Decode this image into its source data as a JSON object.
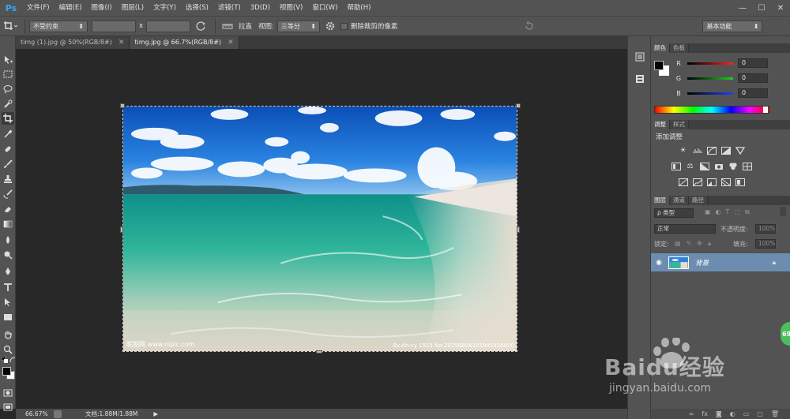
{
  "app": {
    "logo": "Ps",
    "menu": [
      "文件(F)",
      "编辑(E)",
      "图像(I)",
      "图层(L)",
      "文字(Y)",
      "选择(S)",
      "滤镜(T)",
      "3D(D)",
      "视图(V)",
      "窗口(W)",
      "帮助(H)"
    ],
    "window_controls": [
      "—",
      "☐",
      "✕"
    ]
  },
  "options_bar": {
    "constraint_select": "不受约束",
    "x_label": "x",
    "straighten_label": "拉直",
    "view_label": "视图:",
    "view_select": "三等分",
    "delete_cropped_label": "删除裁剪的像素",
    "workspace_select": "基本功能"
  },
  "tabs": [
    {
      "label": "timg (1).jpg @ 50%(RGB/8#)",
      "close": "✕"
    },
    {
      "label": "timg.jpg @ 66.7%(RGB/8#)",
      "close": "✕"
    }
  ],
  "image_watermarks": {
    "left": "昵图网 www.nipic.com",
    "right": "By:Ah-cy 1915 No:20150804101941938000"
  },
  "status": {
    "zoom": "66.67%",
    "doc_info": "文档:1.88M/1.88M",
    "arrow": "▶"
  },
  "color_panel": {
    "tabs": [
      "颜色",
      "色板"
    ],
    "channels": [
      {
        "label": "R",
        "value": "0",
        "color": "#ff2020"
      },
      {
        "label": "G",
        "value": "0",
        "color": "#20d020"
      },
      {
        "label": "B",
        "value": "0",
        "color": "#2040ff"
      }
    ]
  },
  "adjustments_panel": {
    "tabs": [
      "调整",
      "样式"
    ],
    "title": "添加调整"
  },
  "layers_panel": {
    "tabs": [
      "图层",
      "通道",
      "路径"
    ],
    "filter_select": "ρ 类型",
    "blend_select": "正常",
    "opacity_label": "不透明度:",
    "opacity_value": "100%",
    "lock_label": "锁定:",
    "fill_label": "填充:",
    "fill_value": "100%",
    "layer_name": "背景"
  },
  "badge": "69",
  "site_watermark": {
    "brand": "Baidu经验",
    "url": "jingyan.baidu.com"
  }
}
